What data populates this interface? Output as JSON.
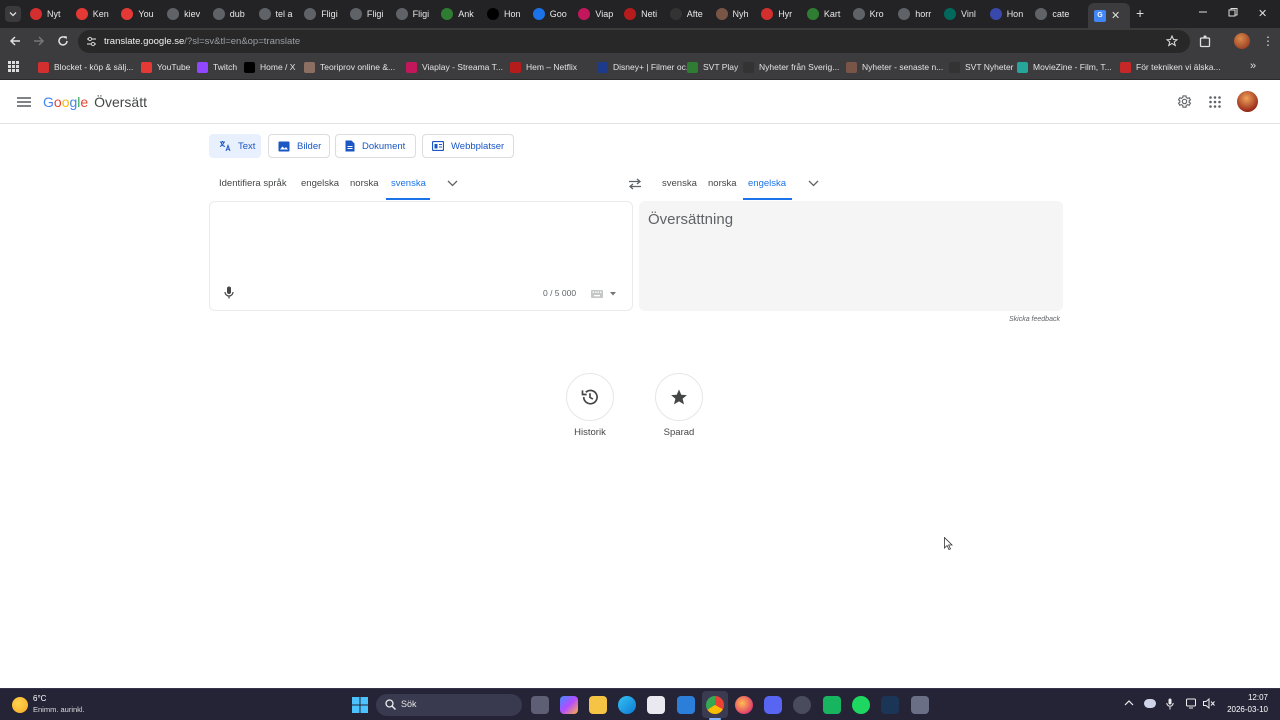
{
  "browser": {
    "tabs": [
      {
        "label": "Nyt",
        "color": "#d32f2f"
      },
      {
        "label": "Ken",
        "color": "#e53935"
      },
      {
        "label": "You",
        "color": "#e53935"
      },
      {
        "label": "kiev",
        "color": "#5f6368"
      },
      {
        "label": "dub",
        "color": "#5f6368"
      },
      {
        "label": "tel a",
        "color": "#5f6368"
      },
      {
        "label": "Fligi",
        "color": "#5f6368"
      },
      {
        "label": "Fligi",
        "color": "#5f6368"
      },
      {
        "label": "Fligi",
        "color": "#5f6368"
      },
      {
        "label": "Ank",
        "color": "#2e7d32"
      },
      {
        "label": "Hon",
        "color": "#000000"
      },
      {
        "label": "Goo",
        "color": "#1a73e8"
      },
      {
        "label": "Viap",
        "color": "#c2185b"
      },
      {
        "label": "Neti",
        "color": "#b71c1c"
      },
      {
        "label": "Afte",
        "color": "#333333"
      },
      {
        "label": "Nyh",
        "color": "#795548"
      },
      {
        "label": "Hyr",
        "color": "#d32f2f"
      },
      {
        "label": "Kart",
        "color": "#2e7d32"
      },
      {
        "label": "Kro",
        "color": "#5f6368"
      },
      {
        "label": "horr",
        "color": "#5f6368"
      },
      {
        "label": "Vinl",
        "color": "#00695c"
      },
      {
        "label": "Hon",
        "color": "#3949ab"
      },
      {
        "label": "cate",
        "color": "#5f6368"
      }
    ],
    "url_host": "translate.google.se",
    "url_path": "/?sl=sv&tl=en&op=translate",
    "bookmarks": [
      {
        "label": "Blocket - köp & sälj...",
        "color": "#d32f2f"
      },
      {
        "label": "YouTube",
        "color": "#e53935"
      },
      {
        "label": "Twitch",
        "color": "#9146ff"
      },
      {
        "label": "Home / X",
        "color": "#000000"
      },
      {
        "label": "Teoriprov online &...",
        "color": "#8d6e63"
      },
      {
        "label": "Viaplay - Streama T...",
        "color": "#c2185b"
      },
      {
        "label": "Hem – Netflix",
        "color": "#b71c1c"
      },
      {
        "label": "Disney+ | Filmer oc...",
        "color": "#1e3a8a"
      },
      {
        "label": "SVT Play",
        "color": "#2e7d32"
      },
      {
        "label": "Nyheter från Sverig...",
        "color": "#333333"
      },
      {
        "label": "Nyheter - senaste n...",
        "color": "#795548"
      },
      {
        "label": "SVT Nyheter",
        "color": "#333333"
      },
      {
        "label": "MovieZine - Film, T...",
        "color": "#26a69a"
      },
      {
        "label": "För tekniken vi älska...",
        "color": "#c62828"
      }
    ]
  },
  "app": {
    "logo_google": "Google",
    "logo_product": "Översätt",
    "modes": [
      "Text",
      "Bilder",
      "Dokument",
      "Webbplatser"
    ],
    "source_langs": [
      "Identifiera språk",
      "engelska",
      "norska",
      "svenska"
    ],
    "target_langs": [
      "svenska",
      "norska",
      "engelska"
    ],
    "char_count": "0 / 5 000",
    "translation_placeholder": "Översättning",
    "feedback": "Skicka feedback",
    "history_label": "Historik",
    "saved_label": "Sparad"
  },
  "taskbar": {
    "weather_temp": "6°C",
    "weather_desc": "Enimm. aurinkl.",
    "search_label": "Sök",
    "time": "12:07",
    "date": "2026-03-10"
  },
  "colors": {
    "accent": "#1a73e8",
    "google_blue": "#4285f4",
    "google_red": "#ea4335",
    "google_yellow": "#fbbc05",
    "google_green": "#34a853"
  }
}
